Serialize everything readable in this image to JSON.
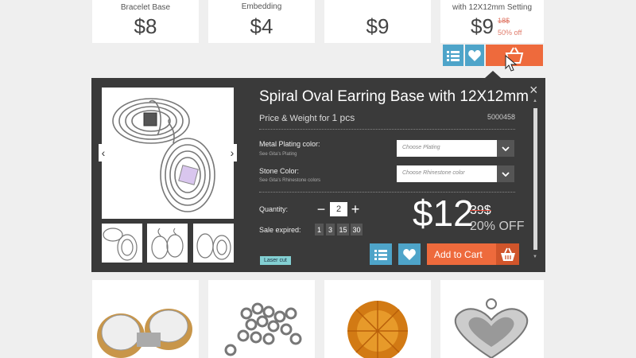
{
  "top_cards": [
    {
      "name": "Bracelet Base",
      "price": "$8"
    },
    {
      "name": "Embedding",
      "price": "$4"
    },
    {
      "name": "",
      "price": "$9"
    },
    {
      "name": "with 12X12mm Setting",
      "price": "$9",
      "old_price": "18$",
      "off": "50% off"
    }
  ],
  "quickview": {
    "title": "Spiral Oval Earring Base with 12X12mm",
    "price_weight_label": "Price & Weight for",
    "quantity_unit": "1 pcs",
    "sku": "5000458",
    "plating_label": "Metal Plating color:",
    "plating_help": "See Gita's Plating",
    "plating_placeholder": "Choose Plating",
    "stone_label": "Stone Color:",
    "stone_help": "See Gita's Rhinestone colors",
    "stone_placeholder": "Choose Rhinestone color",
    "quantity_label": "Quantity:",
    "quantity_value": "2",
    "sale_label": "Sale expired:",
    "countdown": [
      "1",
      "3",
      "15",
      "30"
    ],
    "price": "$12",
    "old_price": "39$",
    "off": "20% OFF",
    "tag": "Laser cut",
    "add_to_cart": "Add to Cart",
    "close": "×"
  },
  "colors": {
    "panel": "#3a3a3a",
    "accent_orange": "#ee6a3c",
    "accent_blue": "#4ea4c9",
    "badge": "#83d0d3"
  }
}
